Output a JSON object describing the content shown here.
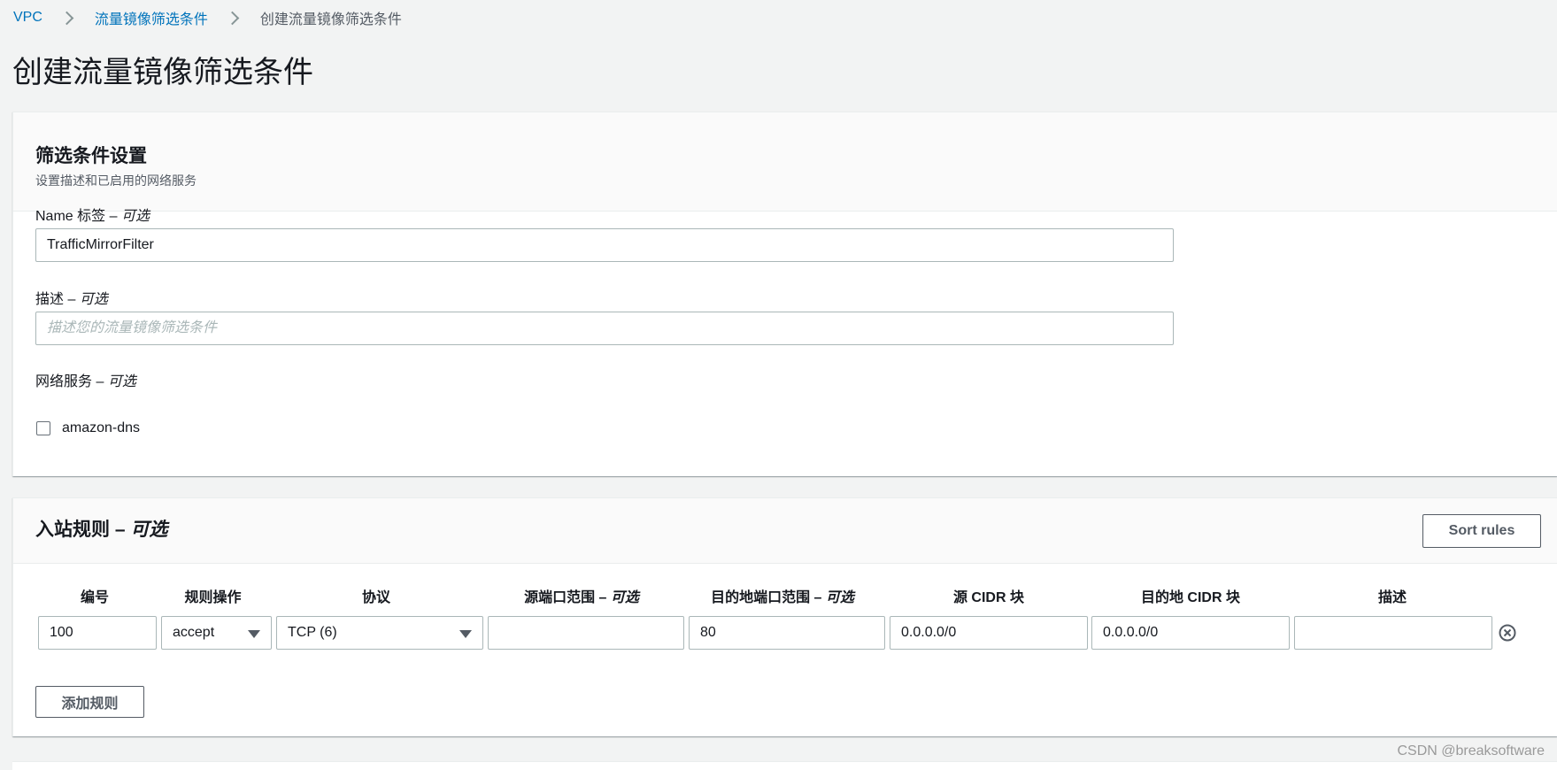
{
  "breadcrumb": {
    "items": [
      "VPC",
      "流量镜像筛选条件"
    ],
    "current": "创建流量镜像筛选条件"
  },
  "page_title": "创建流量镜像筛选条件",
  "filter_settings": {
    "title": "筛选条件设置",
    "subtitle": "设置描述和已启用的网络服务",
    "name_label": "Name 标签",
    "optional_sep": " – ",
    "optional": "可选",
    "name_value": "TrafficMirrorFilter",
    "description_label": "描述",
    "description_placeholder": "描述您的流量镜像筛选条件",
    "network_services_label": "网络服务",
    "service_option": "amazon-dns"
  },
  "inbound_rules": {
    "title": "入站规则",
    "optional_sep": " – ",
    "optional": "可选",
    "sort_button": "Sort rules",
    "columns": {
      "number": "编号",
      "action": "规则操作",
      "protocol": "协议",
      "src_port": "源端口范围",
      "dst_port": "目的地端口范围",
      "src_cidr": "源 CIDR 块",
      "dst_cidr": "目的地 CIDR 块",
      "description": "描述"
    },
    "optional_suffix": " – 可选",
    "row": {
      "number": "100",
      "action": "accept",
      "protocol": "TCP (6)",
      "src_port": "",
      "dst_port": "80",
      "src_cidr": "0.0.0.0/0",
      "dst_cidr": "0.0.0.0/0",
      "description": ""
    },
    "add_rule_button": "添加规则"
  },
  "watermark": "CSDN @breaksoftware",
  "colors": {
    "link": "#0073bb",
    "background": "#f2f3f3",
    "border": "#aab7b8"
  }
}
